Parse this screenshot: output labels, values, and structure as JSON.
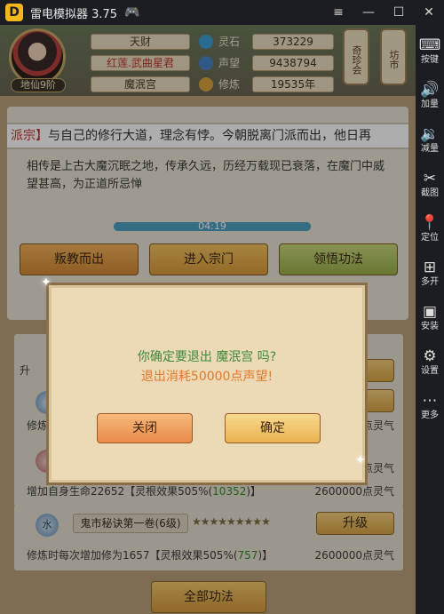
{
  "window": {
    "title": "雷电模拟器 3.75",
    "logo_letter": "D",
    "minimize": "—",
    "maximize": "☐",
    "close": "✕",
    "menu": "≡",
    "gamepad": "🎮"
  },
  "sidebar": [
    {
      "icon": "⌨",
      "label": "按键"
    },
    {
      "icon": "🔊",
      "label": "加量"
    },
    {
      "icon": "🔉",
      "label": "减量"
    },
    {
      "icon": "✂",
      "label": "截图"
    },
    {
      "icon": "📍",
      "label": "定位"
    },
    {
      "icon": "⊞",
      "label": "多开"
    },
    {
      "icon": "▣",
      "label": "安装"
    },
    {
      "icon": "⚙",
      "label": "设置"
    },
    {
      "icon": "⋯",
      "label": "更多"
    }
  ],
  "header": {
    "rank": "地仙9阶",
    "cells": [
      "天财",
      "红莲.武曲星君",
      "魔泯宫"
    ],
    "stats": [
      {
        "label": "灵石",
        "value": "373229",
        "color": "#3b9ed4"
      },
      {
        "label": "声望",
        "value": "9438794",
        "color": "#4a82c7"
      },
      {
        "label": "修炼",
        "value": "19535年",
        "color": "#d9a441"
      }
    ],
    "signs": [
      "奇珍会",
      "坊市"
    ]
  },
  "panel": {
    "marquee_red": "派宗】",
    "marquee_text": "与自己的修行大道，理念有悖。今朝脱离门派而出，他日再",
    "description": "相传是上古大魔沉眠之地，传承久远，历经万载现已衰落，在魔门中威望甚高，为正道所忌惮",
    "timer": "04:19",
    "progress": 1.0,
    "buttons": [
      "叛教而出",
      "进入宗门",
      "领悟功法"
    ]
  },
  "techniques": {
    "partial_labels": {
      "left_1": "升",
      "desc_2": "修炼",
      "upgrade_1": "级",
      "upgrade_2": "级",
      "cost_2": "点灵气",
      "cost_3": "点灵气"
    },
    "row3": {
      "desc_prefix": "增加自身生命22652【灵根效果505%(",
      "desc_green": "10352",
      "desc_suffix": ")】",
      "cost": "2600000点灵气"
    },
    "row4": {
      "ball": "水",
      "name": "鬼市秘诀第一卷(6级)",
      "stars": "★★★★★★★★★",
      "upgrade": "升级",
      "desc_prefix": "修炼时每次增加修为1657【灵根效果505%(",
      "desc_green": "757",
      "desc_suffix": ")】",
      "cost": "2600000点灵气"
    },
    "all_button": "全部功法"
  },
  "dialog": {
    "question": "你确定要退出 魔泯宫 吗?",
    "cost": "退出消耗50000点声望!",
    "close_label": "关闭",
    "confirm_label": "确定"
  }
}
